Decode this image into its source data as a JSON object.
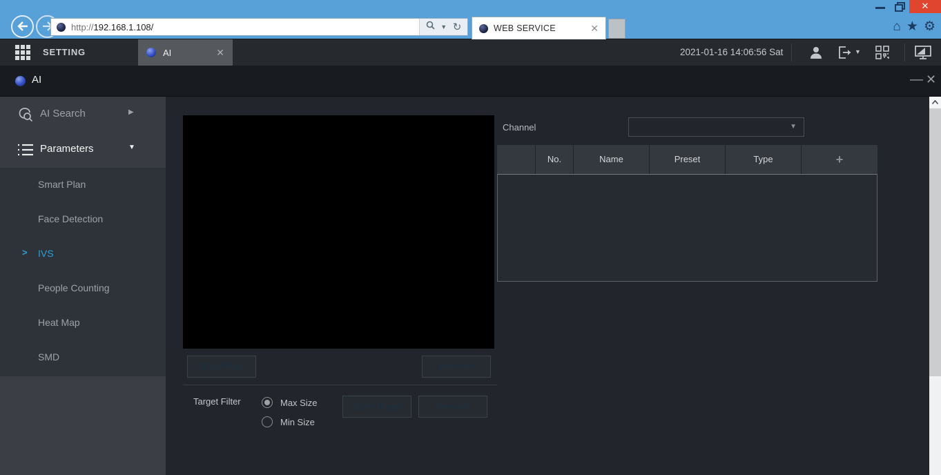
{
  "browser": {
    "url_scheme": "http://",
    "url_host": "192.168.1.108/",
    "tab_title": "WEB SERVICE"
  },
  "header": {
    "setting_label": "SETTING",
    "ai_tab_label": "AI",
    "datetime": "2021-01-16 14:06:56 Sat"
  },
  "window": {
    "title": "AI"
  },
  "sidebar": {
    "groups": [
      {
        "label": "AI Search",
        "expanded": false
      },
      {
        "label": "Parameters",
        "expanded": true
      }
    ],
    "items": [
      "Smart Plan",
      "Face Detection",
      "IVS",
      "People Counting",
      "Heat Map",
      "SMD"
    ],
    "active_item": "IVS"
  },
  "main": {
    "channel": {
      "label": "Channel",
      "value": ""
    },
    "buttons": {
      "draw_rule": "Draw Rule",
      "remove_rule": "Remove",
      "draw_target": "Draw Target",
      "remove_target": "Remove"
    },
    "target_filter": {
      "label": "Target Filter",
      "options": [
        "Max Size",
        "Min Size"
      ],
      "selected": "Max Size"
    },
    "table": {
      "columns": [
        "",
        "No.",
        "Name",
        "Preset",
        "Type",
        "+"
      ],
      "rows": []
    }
  },
  "colors": {
    "accent_blue": "#2f9fd8",
    "browser_blue": "#58a0d8",
    "close_red": "#e0452f",
    "content_bg": "#22262c"
  }
}
